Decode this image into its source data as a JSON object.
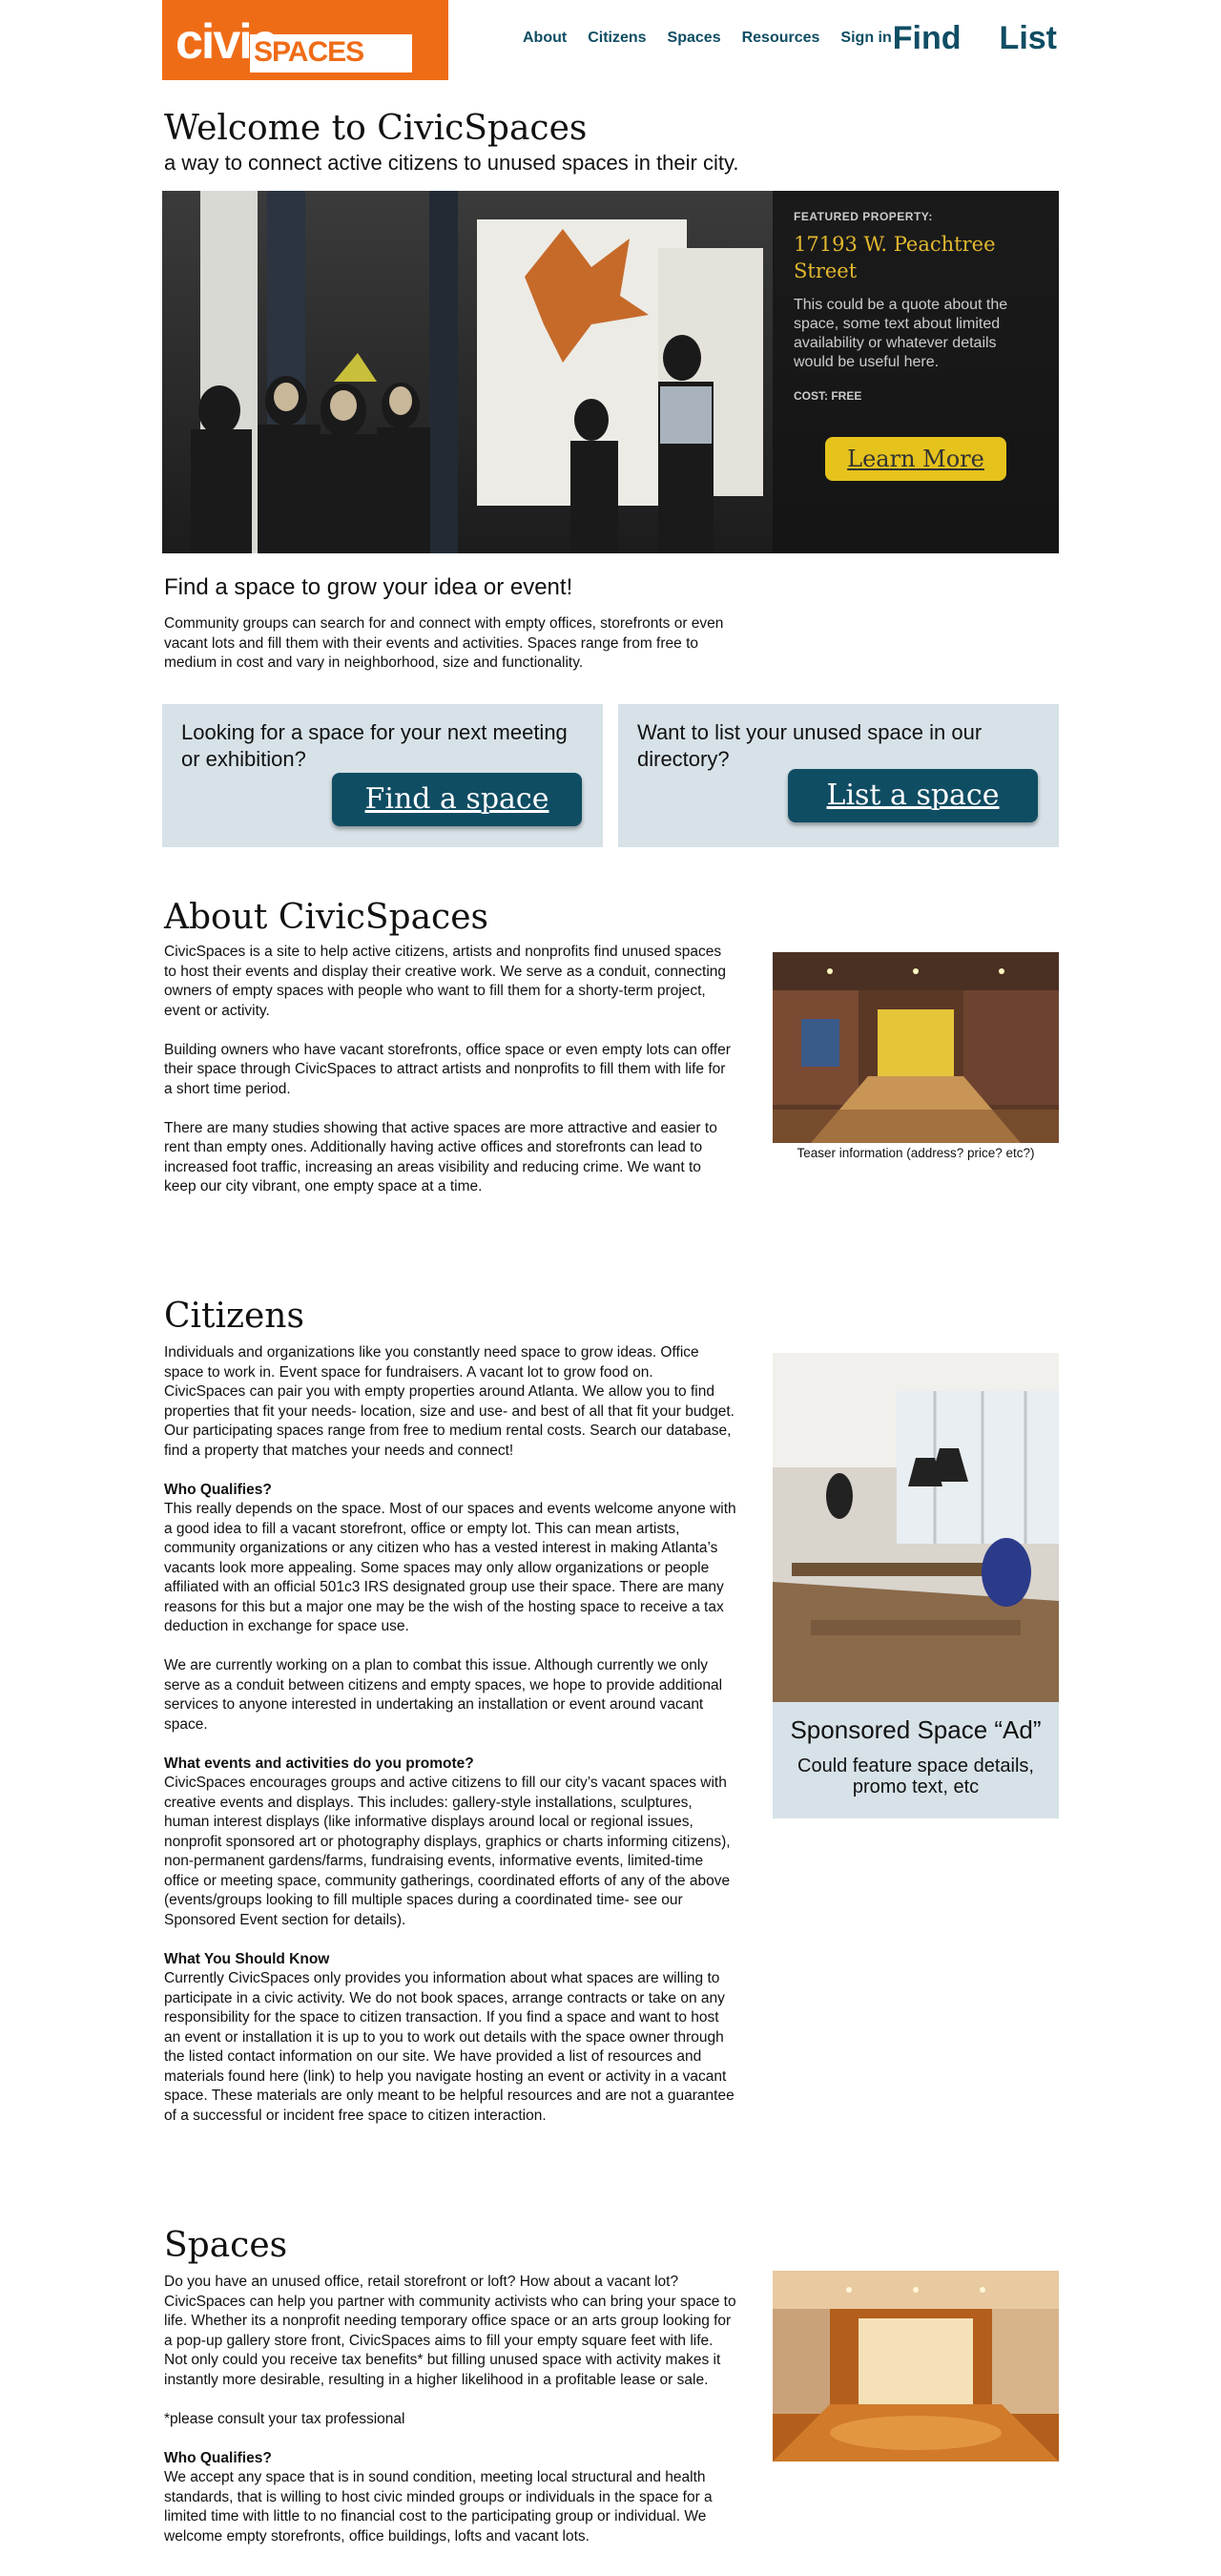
{
  "header": {
    "logo_word1": "civic",
    "logo_word2": "SPACES",
    "nav": [
      "About",
      "Citizens",
      "Spaces",
      "Resources",
      "Sign in"
    ],
    "big_nav": [
      "Find",
      "List"
    ]
  },
  "welcome": {
    "title": "Welcome to CivicSpaces",
    "tagline": "a way to connect active citizens to unused spaces in their city."
  },
  "featured": {
    "label": "FEATURED PROPERTY:",
    "address": "17193 W. Peachtree Street",
    "description": "This could be a quote about the space, some text about limited availability or whatever details would be useful here.",
    "cost": "COST: FREE",
    "button": "Learn More"
  },
  "find": {
    "title": "Find a space to grow your idea or event!",
    "text": "Community groups can search for and connect with empty offices, storefronts or even vacant lots and fill them with their events and activities. Spaces range from free to medium in cost and vary in neighborhood, size and functionality."
  },
  "cta": {
    "left_text": "Looking for a space for your next meeting or exhibition?",
    "left_button": "Find a space",
    "right_text": "Want to list your unused space in our directory?",
    "right_button": "List a space"
  },
  "about": {
    "title": "About CivicSpaces",
    "paragraphs": [
      "CivicSpaces is a site to help active citizens, artists and nonprofits find unused spaces to host their events and display their creative work. We serve as a conduit, connecting owners of empty spaces with people who want to fill them for a shorty-term project, event or activity.",
      "Building owners who have vacant storefronts, office space or even empty lots can offer their space through CivicSpaces to attract artists and nonprofits to fill them with life for a short time period.",
      "There are many studies showing that active spaces are more attractive and easier to rent than empty ones. Additionally having active offices and storefronts can lead to increased foot traffic, increasing an areas visibility and reducing crime. We want to keep our city vibrant, one empty space at a time."
    ],
    "photo_caption": "Teaser information (address? price? etc?)"
  },
  "citizens": {
    "title": "Citizens",
    "intro": "Individuals and organizations like you constantly need space to grow ideas. Office space to work in. Event space for fundraisers. A vacant lot to grow food on. CivicSpaces can pair you with empty properties around Atlanta. We allow you to find properties that fit your needs- location, size and use- and best of all that fit your budget. Our participating spaces range from free to medium rental costs. Search our database, find a property that matches your needs and connect!",
    "q1_title": "Who Qualifies?",
    "q1_text": "This really depends on the space. Most of our spaces and events welcome anyone with a good idea to fill a vacant storefront, office or empty lot. This can mean artists, community organizations or any citizen who has a vested interest in making Atlanta’s vacants look more appealing. Some spaces may only allow organizations or people affiliated with an official 501c3 IRS designated group use their space. There are many reasons for this but a major one may be the wish of the hosting space to receive a tax deduction in exchange for space use.",
    "q1_text2": "We are currently working on a plan to combat this issue. Although currently we only serve as a conduit between citizens and empty spaces, we hope to provide additional services to anyone interested in undertaking an installation or event around vacant space.",
    "q2_title": "What events and activities do you promote?",
    "q2_text": "CivicSpaces encourages groups and active citizens to fill our city’s vacant spaces with creative events and displays. This includes: gallery-style installations, sculptures, human interest displays (like informative displays around local or regional issues, nonprofit sponsored art or photography displays, graphics or charts informing citizens), non-permanent gardens/farms, fundraising events, informative events, limited-time office or meeting space, community gatherings, coordinated efforts of any of the above (events/groups looking to fill multiple spaces during a coordinated time- see our Sponsored Event section for details).",
    "q3_title": "What You Should Know",
    "q3_text": "Currently CivicSpaces only provides you information about what spaces are willing to participate in a civic activity. We do not book spaces, arrange contracts or take on any responsibility for the space to citizen transaction. If you find a space and want to host an event or installation it is up to you to work out details with the space owner through the listed contact information on our site. We have provided a list of resources and materials found here (link) to help you navigate hosting an event or activity in a vacant space. These materials are only meant to be helpful resources and are not a guarantee of a successful or incident free space to citizen interaction.",
    "ad_title": "Sponsored Space “Ad”",
    "ad_text": "Could feature space details, promo text, etc"
  },
  "spaces": {
    "title": "Spaces",
    "intro": "Do you have an unused office, retail storefront or loft? How about a vacant lot? CivicSpaces can help you partner with community activists who can bring your space to life. Whether its a nonprofit needing temporary office space or an arts group looking for a pop-up gallery store front, CivicSpaces aims to fill your empty square feet with life. Not only could you receive tax benefits* but filling unused space with activity makes it instantly more desirable, resulting in a higher likelihood in a profitable lease or sale.",
    "footnote": "*please consult your tax professional",
    "q_title": "Who Qualifies?",
    "q_text": "We accept any space that is in sound condition, meeting local structural and health standards, that is willing to host civic minded groups or individuals in the space for a limited time with little to no financial cost to the participating group or individual. We welcome empty storefronts, office buildings, lofts and vacant lots."
  }
}
